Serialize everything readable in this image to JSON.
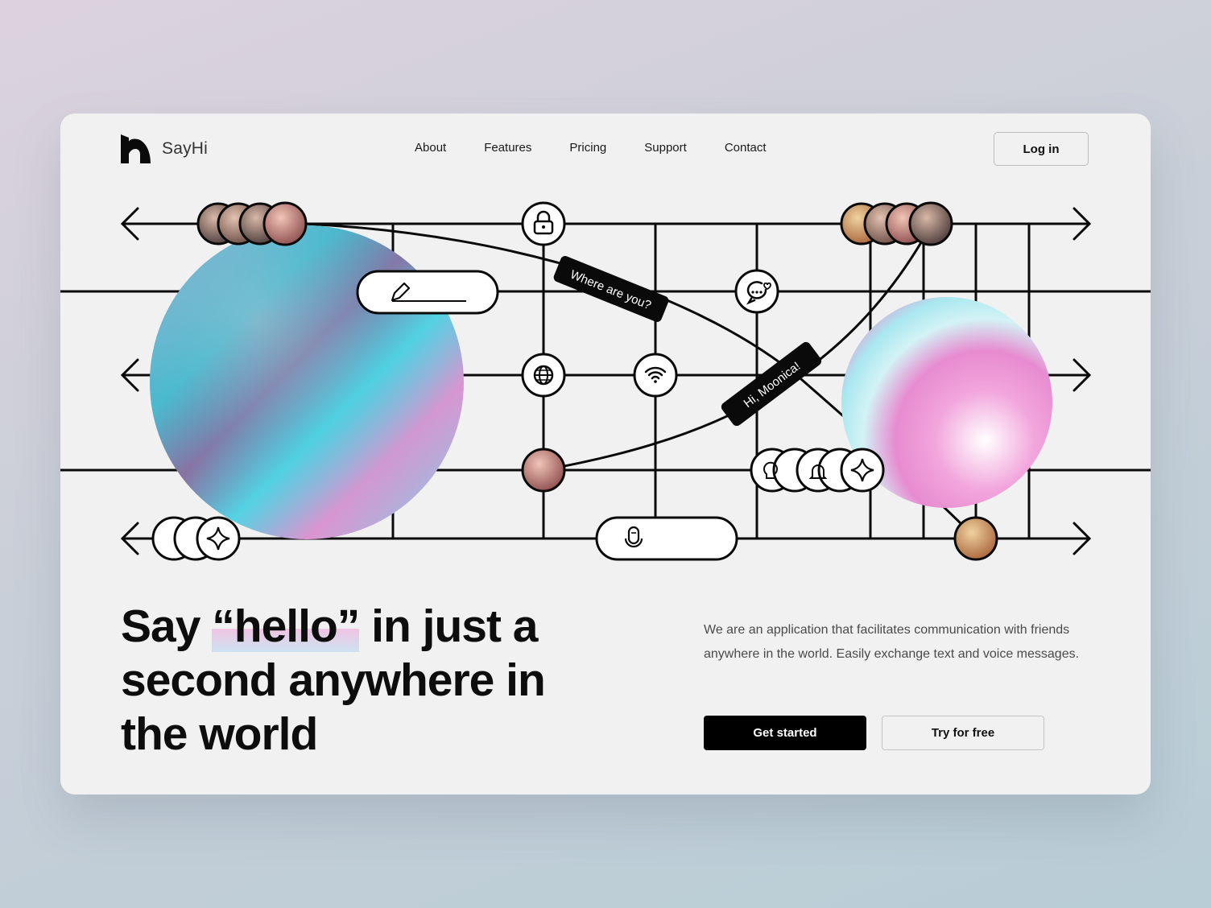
{
  "brand": {
    "name": "SayHi",
    "logo_icon": "sayhi-logo-mark"
  },
  "nav": {
    "items": [
      {
        "label": "About"
      },
      {
        "label": "Features"
      },
      {
        "label": "Pricing"
      },
      {
        "label": "Support"
      },
      {
        "label": "Contact"
      }
    ],
    "login_label": "Log in"
  },
  "hero": {
    "headline_before": "Say ",
    "headline_highlight": "“hello”",
    "headline_after": " in just a second anywhere in the world",
    "description": "We are an application that facilitates communication with friends anywhere in the world. Easily exchange text and voice messages.",
    "primary_cta": "Get started",
    "secondary_cta": "Try for free"
  },
  "diagram": {
    "message_1": "Where are you?",
    "message_2": "Hi, Moonica!",
    "icons": [
      "lock-icon",
      "chat-heart-icon",
      "globe-icon",
      "wifi-icon",
      "pencil-icon",
      "microphone-icon",
      "sparkle-icon",
      "lightbulb-icon",
      "bell-icon"
    ],
    "colors": {
      "line": "#0a0a0a",
      "accent_pink": "#f08ccf",
      "accent_cyan": "#4fd0e6"
    }
  }
}
